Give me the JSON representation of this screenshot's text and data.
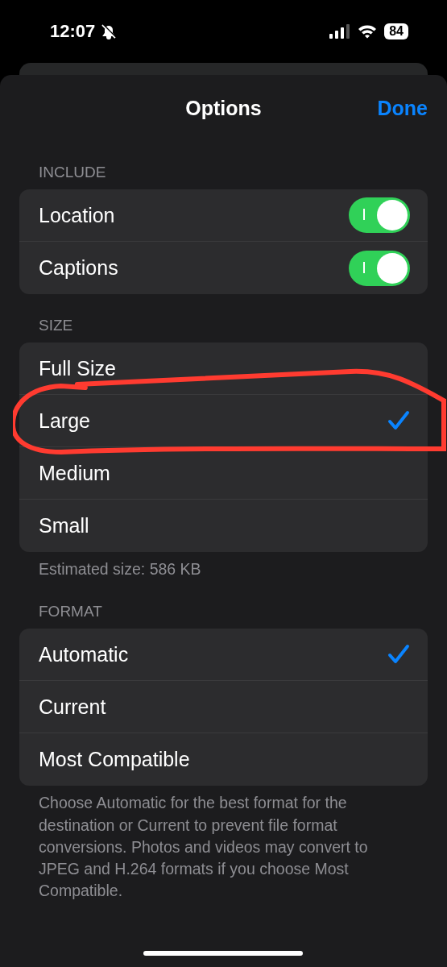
{
  "status_bar": {
    "time": "12:07",
    "silent": true,
    "battery": "84"
  },
  "sheet": {
    "title": "Options",
    "done": "Done"
  },
  "include": {
    "header": "INCLUDE",
    "items": [
      {
        "label": "Location",
        "on": true
      },
      {
        "label": "Captions",
        "on": true
      }
    ]
  },
  "size": {
    "header": "SIZE",
    "options": [
      {
        "label": "Full Size",
        "selected": false
      },
      {
        "label": "Large",
        "selected": true,
        "circled": true
      },
      {
        "label": "Medium",
        "selected": false
      },
      {
        "label": "Small",
        "selected": false
      }
    ],
    "note": "Estimated size: 586 KB"
  },
  "format": {
    "header": "FORMAT",
    "options": [
      {
        "label": "Automatic",
        "selected": true
      },
      {
        "label": "Current",
        "selected": false
      },
      {
        "label": "Most Compatible",
        "selected": false
      }
    ],
    "note": "Choose Automatic for the best format for the destination or Current to prevent file format conversions. Photos and videos may convert to JPEG and H.264 formats if you choose Most Compatible."
  },
  "sheet_behind": true
}
